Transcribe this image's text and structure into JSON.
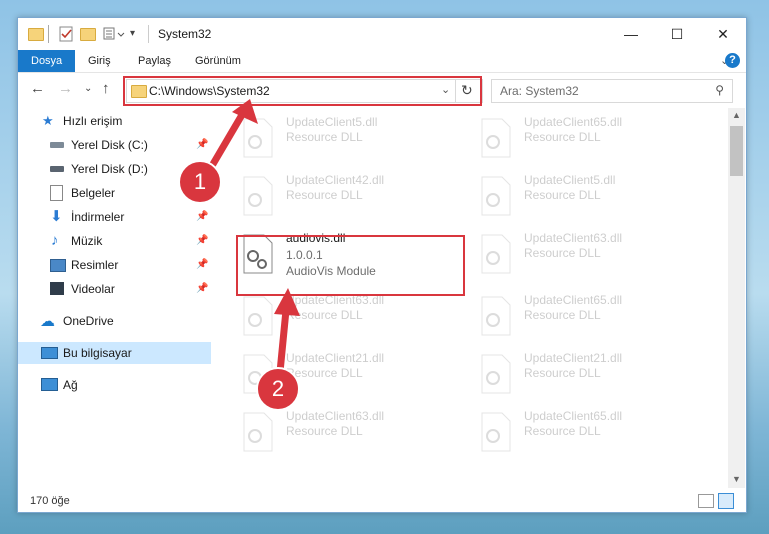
{
  "window": {
    "title": "System32"
  },
  "ribbon": {
    "tabs": [
      "Dosya",
      "Giriş",
      "Paylaş",
      "Görünüm"
    ],
    "help": "?"
  },
  "window_controls": {
    "minimize": "—",
    "maximize": "☐",
    "close": "✕"
  },
  "address": {
    "path": "C:\\Windows\\System32"
  },
  "search": {
    "placeholder": "Ara: System32"
  },
  "sidebar": {
    "quick_access": "Hızlı erişim",
    "items": [
      "Yerel Disk (C:)",
      "Yerel Disk (D:)",
      "Belgeler",
      "İndirmeler",
      "Müzik",
      "Resimler",
      "Videolar"
    ],
    "onedrive": "OneDrive",
    "this_pc": "Bu bilgisayar",
    "network": "Ağ"
  },
  "files": {
    "left": [
      {
        "name": "UpdateClient5.dll",
        "sub": "Resource DLL"
      },
      {
        "name": "UpdateClient42.dll",
        "sub": "Resource DLL"
      },
      {
        "name": "UpdateClient63.dll",
        "sub": "Resource DLL"
      },
      {
        "name": "UpdateClient21.dll",
        "sub": "Resource DLL"
      },
      {
        "name": "UpdateClient63.dll",
        "sub": "Resource DLL"
      }
    ],
    "right": [
      {
        "name": "UpdateClient65.dll",
        "sub": "Resource DLL"
      },
      {
        "name": "UpdateClient5.dll",
        "sub": "Resource DLL"
      },
      {
        "name": "UpdateClient63.dll",
        "sub": "Resource DLL"
      },
      {
        "name": "UpdateClient65.dll",
        "sub": "Resource DLL"
      },
      {
        "name": "UpdateClient21.dll",
        "sub": "Resource DLL"
      },
      {
        "name": "UpdateClient65.dll",
        "sub": "Resource DLL"
      }
    ],
    "selected": {
      "name": "audiovis.dll",
      "version": "1.0.0.1",
      "description": "AudioVis Module"
    }
  },
  "status": {
    "count": "170 öğe"
  },
  "annotations": {
    "step1": "1",
    "step2": "2",
    "color": "#d9363e"
  }
}
